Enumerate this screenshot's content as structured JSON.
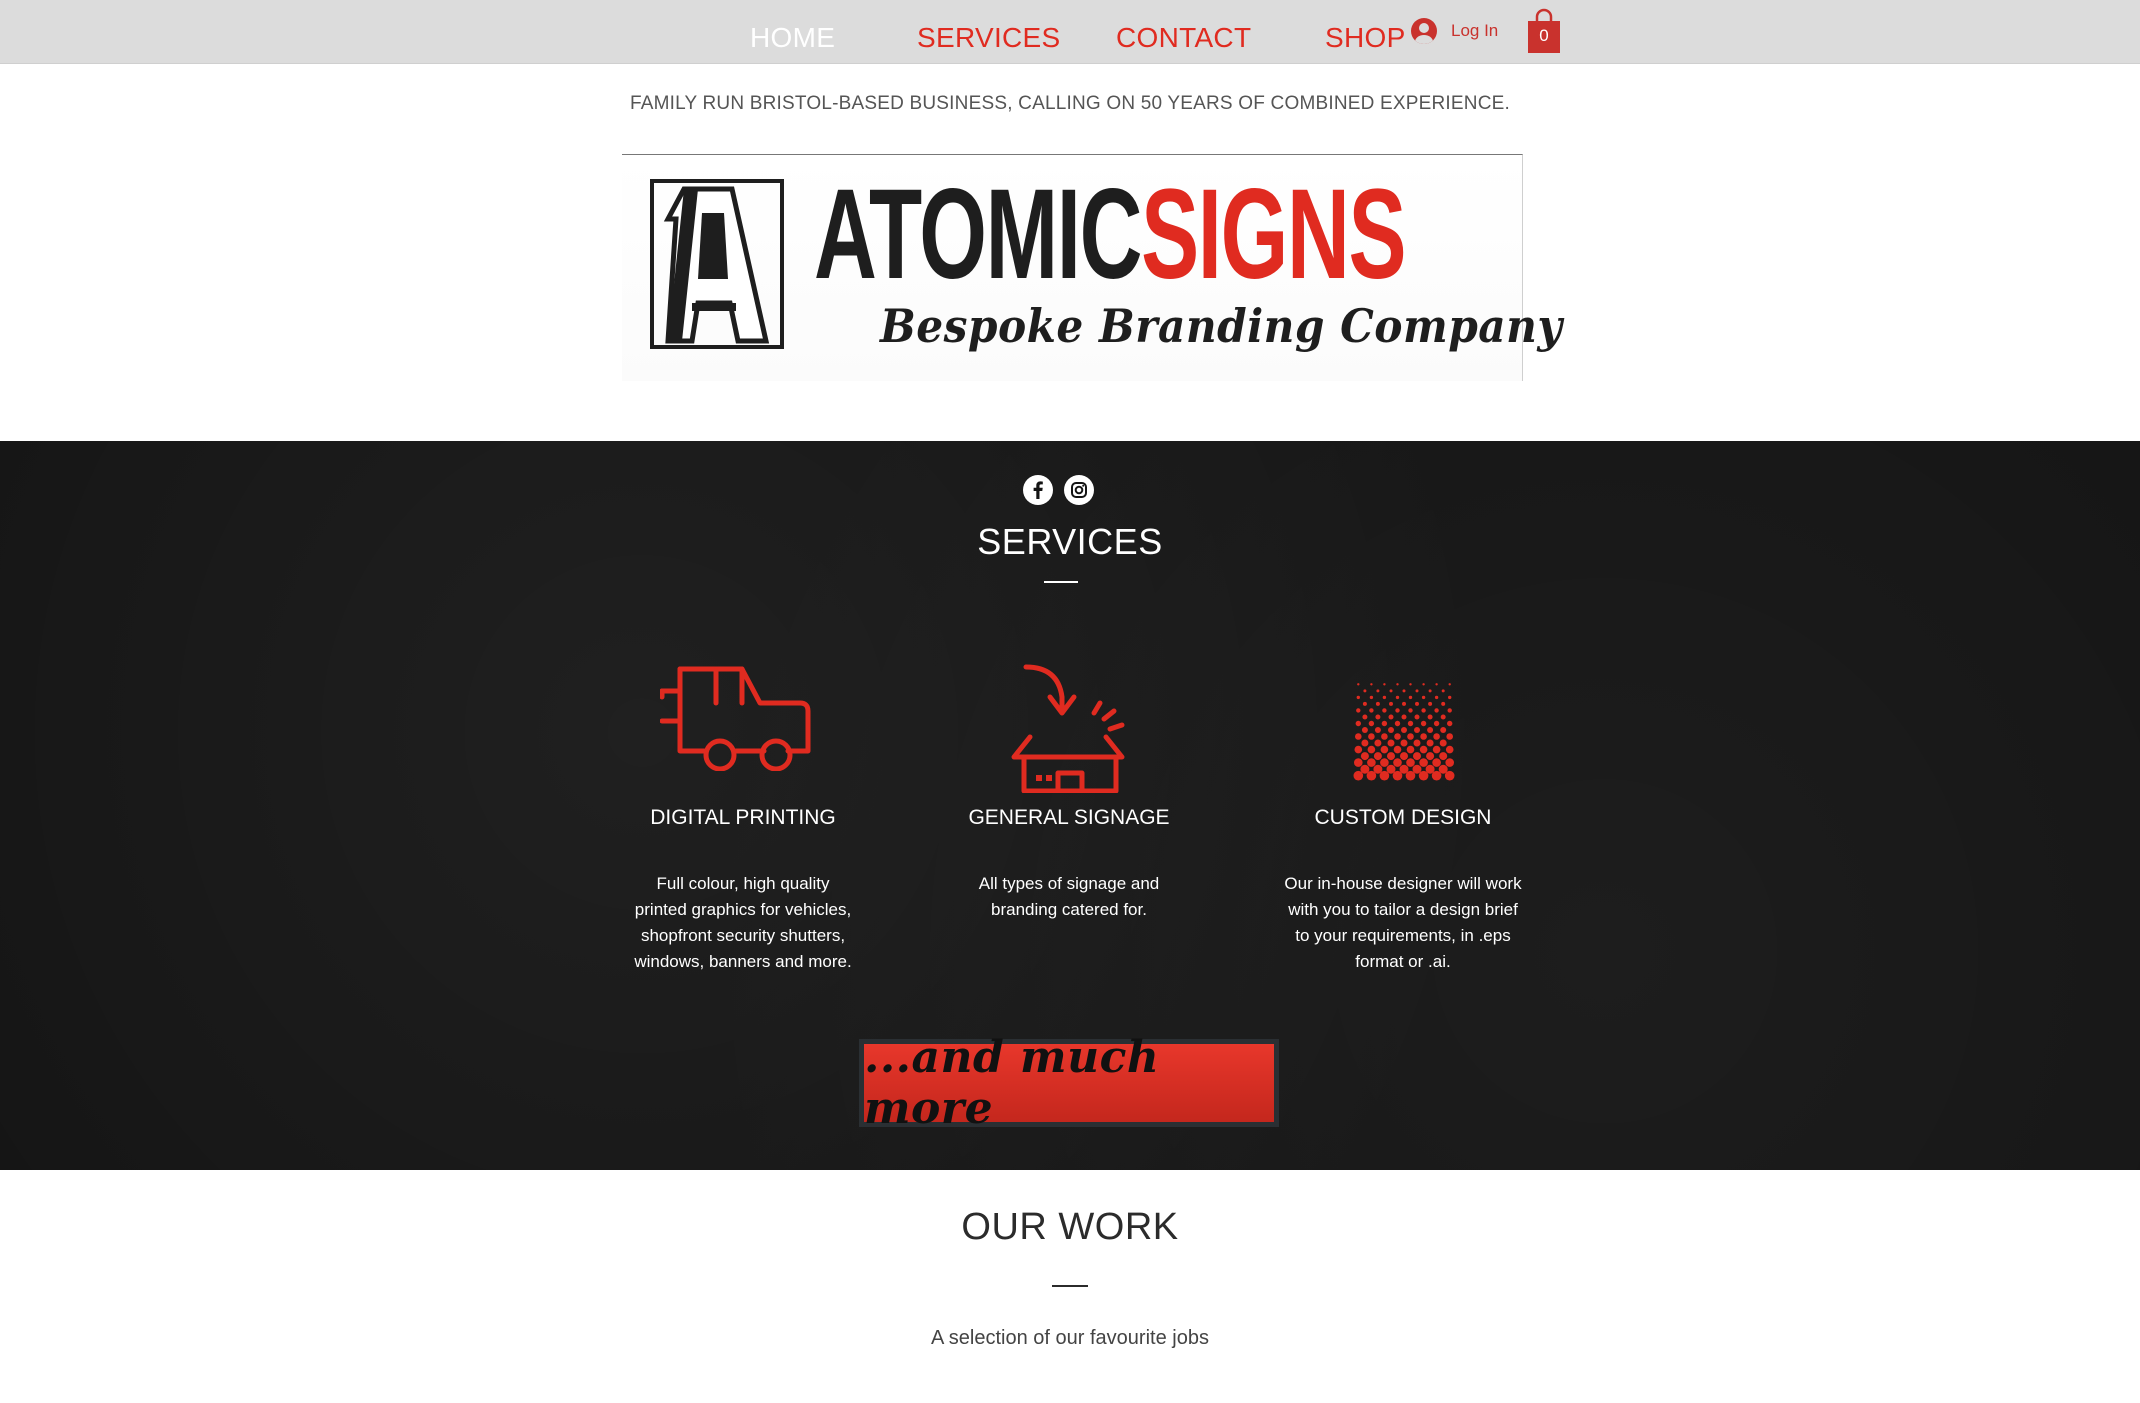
{
  "nav": {
    "items": [
      {
        "label": "HOME"
      },
      {
        "label": "SERVICES"
      },
      {
        "label": "CONTACT"
      },
      {
        "label": "SHOP"
      }
    ],
    "login_label": "Log In",
    "cart_count": "0"
  },
  "tagline": "FAMILY RUN BRISTOL-BASED BUSINESS, CALLING ON 50 YEARS OF COMBINED EXPERIENCE.",
  "logo": {
    "word_dark": "ATOMIC",
    "word_red": "SIGNS",
    "tagline": "Bespoke Branding Company",
    "monogram": "A"
  },
  "social": {
    "icons": [
      "facebook-icon",
      "instagram-icon"
    ]
  },
  "services": {
    "title": "SERVICES",
    "items": [
      {
        "icon": "delivery-van-icon",
        "heading": "DIGITAL PRINTING",
        "lines": [
          "Full colour, high quality",
          "printed graphics for vehicles,",
          "shopfront security shutters,",
          "windows, banners and more."
        ]
      },
      {
        "icon": "storefront-arrow-icon",
        "heading": "GENERAL SIGNAGE",
        "lines": [
          "All types of signage and",
          "branding catered for."
        ]
      },
      {
        "icon": "halftone-diamond-icon",
        "heading": "CUSTOM DESIGN",
        "lines": [
          "Our in-house designer will work",
          "with you to tailor a design brief",
          "to your requirements, in .eps",
          "format or .ai."
        ]
      }
    ],
    "more_button": "...and much more"
  },
  "our_work": {
    "title": "OUR WORK",
    "subtitle": "A selection of our favourite jobs"
  },
  "colors": {
    "accent_red": "#e02b20",
    "nav_bg": "#dcdcdc",
    "dark_bg": "#141414"
  }
}
